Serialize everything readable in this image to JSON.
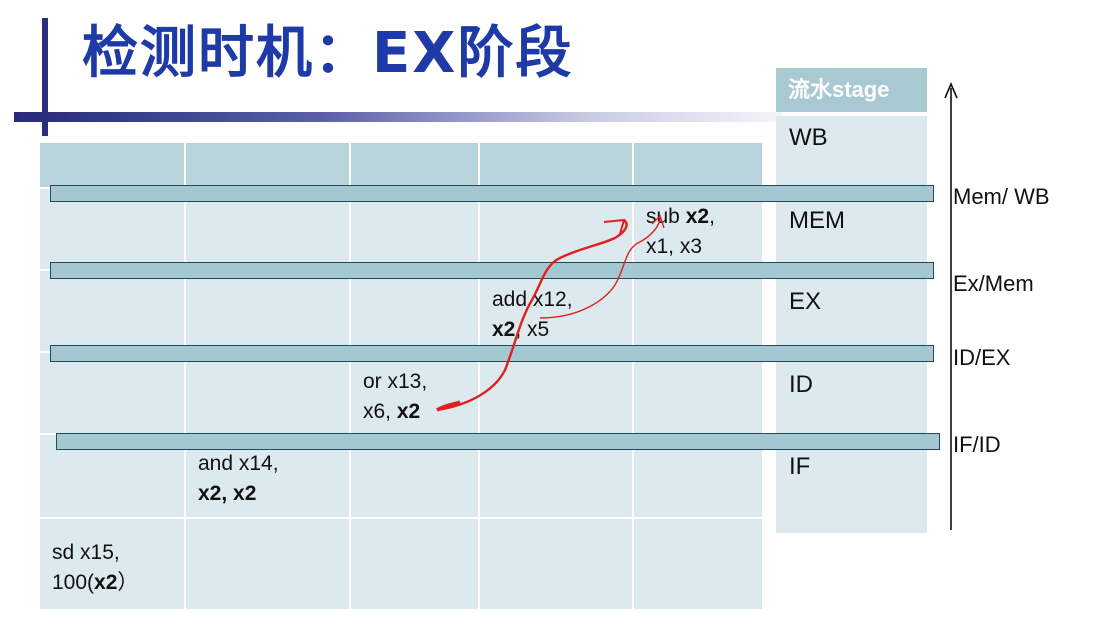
{
  "title": "检测时机：EX阶段",
  "stage_column": {
    "header": "流水stage",
    "stages": [
      "WB",
      "MEM",
      "EX",
      "ID",
      "IF"
    ]
  },
  "pipeline_registers": [
    "Mem/ WB",
    "Ex/Mem",
    "ID/EX",
    "IF/ID"
  ],
  "instructions": {
    "sub": {
      "pre": "sub ",
      "reg_bold": "x2",
      "post": ",",
      "line2": "x1, x3"
    },
    "add": {
      "line1": "add x12,",
      "reg_bold": "x2",
      "post": ", x5"
    },
    "or": {
      "line1": "or x13,",
      "pre": "x6, ",
      "reg_bold": "x2"
    },
    "and": {
      "line1": "and x14,",
      "regs_bold": "x2, x2"
    },
    "sd": {
      "line1": "sd x15,",
      "pre": "100(",
      "reg_bold": "x2",
      "post": "）"
    }
  },
  "colors": {
    "title": "#1e3aa6",
    "cell_light": "#dce9ee",
    "cell_dark": "#b7d3db",
    "register": "#a3c8d2",
    "forward_arrow": "#e02020"
  }
}
